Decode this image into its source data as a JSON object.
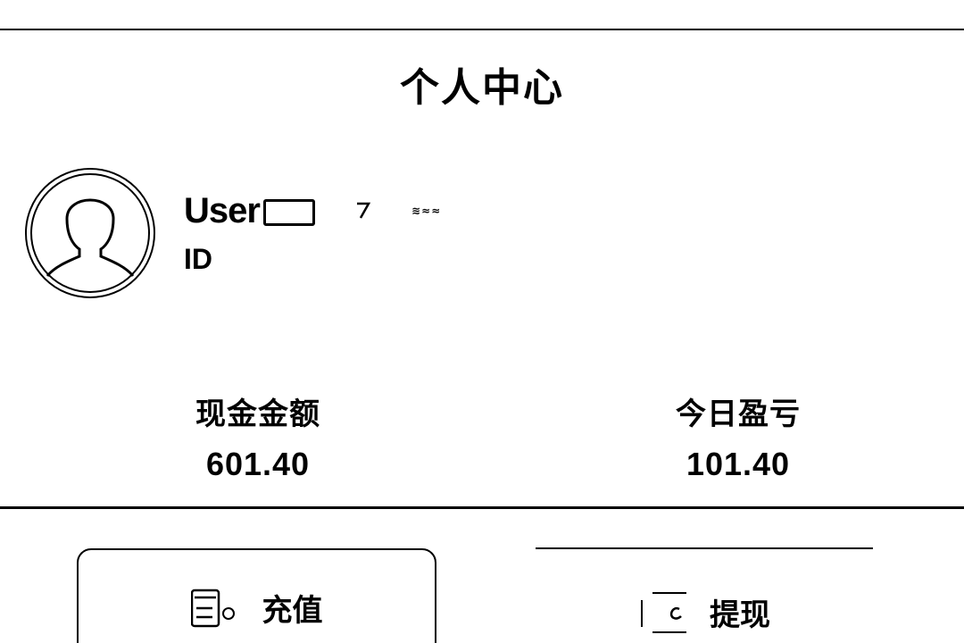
{
  "header": {
    "title": "个人中心"
  },
  "profile": {
    "avatar_icon": "user-avatar-icon",
    "username": "User",
    "tag": "≋≈≈",
    "id_label": "ID"
  },
  "stats": {
    "cash_label": "现金金额",
    "cash_value": "601.40",
    "pnl_label": "今日盈亏",
    "pnl_value": "101.40"
  },
  "actions": {
    "deposit_label": "充值",
    "deposit_icon": "wallet-icon",
    "withdraw_label": "提现",
    "withdraw_icon": "card-icon"
  }
}
